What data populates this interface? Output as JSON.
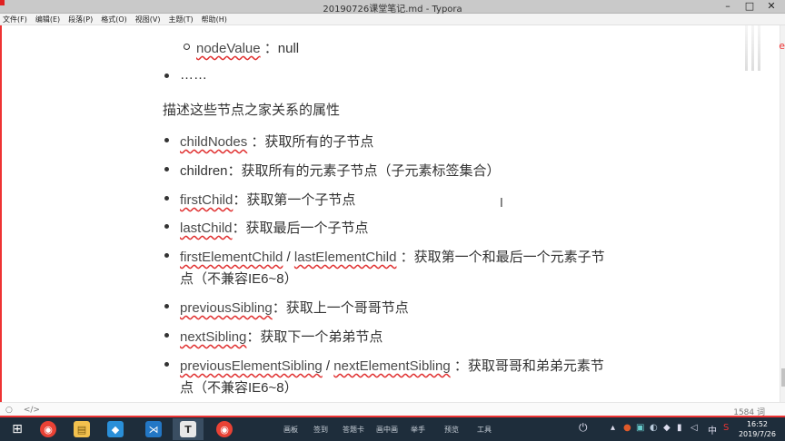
{
  "window": {
    "title": "20190726课堂笔记.md - Typora",
    "controls": [
      "–",
      "□",
      "✕"
    ]
  },
  "menu": [
    "文件(F)",
    "编辑(E)",
    "段落(P)",
    "格式(O)",
    "视图(V)",
    "主题(T)",
    "帮助(H)"
  ],
  "content": {
    "sub_item": {
      "term": "nodeValue",
      "text": " ：null"
    },
    "ellipsis_item": "……",
    "paragraph": "描述这些节点之家关系的属性",
    "items": [
      {
        "term": "childNodes",
        "text": " ：获取所有的子节点"
      },
      {
        "plain": "children：获取所有的元素子节点（子元素标签集合）"
      },
      {
        "term": "firstChild",
        "text": "：获取第一个子节点"
      },
      {
        "term": "lastChild",
        "text": "：获取最后一个子节点"
      },
      {
        "term": "firstElementChild",
        "sep": " / ",
        "term2": "lastElementChild",
        "text": " ：获取第一个和最后一个元素子节",
        "line2": "点（不兼容IE6~8）"
      },
      {
        "term": "previousSibling",
        "text": "：获取上一个哥哥节点"
      },
      {
        "term": "nextSibling",
        "text": "：获取下一个弟弟节点"
      },
      {
        "term": "previousElementSibling",
        "sep": " / ",
        "term2": "nextElementSibling",
        "text": " ：获取哥哥和弟弟元素节",
        "line2": "点（不兼容IE6~8）"
      },
      {
        "plain": "……"
      }
    ],
    "edge_char": "e"
  },
  "statusbar": {
    "left_icons": [
      "○",
      "</>"
    ],
    "word_count": "1584 词"
  },
  "taskbar": {
    "apps": [
      {
        "name": "start",
        "glyph": "⊞"
      },
      {
        "name": "chrome",
        "glyph": "◉"
      },
      {
        "name": "file-explorer",
        "glyph": "▤"
      },
      {
        "name": "app-blue",
        "glyph": "◆"
      },
      {
        "name": "vscode",
        "glyph": "⋊"
      },
      {
        "name": "typora",
        "glyph": "T"
      },
      {
        "name": "chrome",
        "glyph": "◉"
      }
    ],
    "toolbar_items": [
      "画板",
      "签到",
      "答题卡",
      "画中画",
      "举手",
      "预览",
      "工具"
    ],
    "tray_lang": "中",
    "clock_time": "16:52",
    "clock_date": "2019/7/26"
  }
}
